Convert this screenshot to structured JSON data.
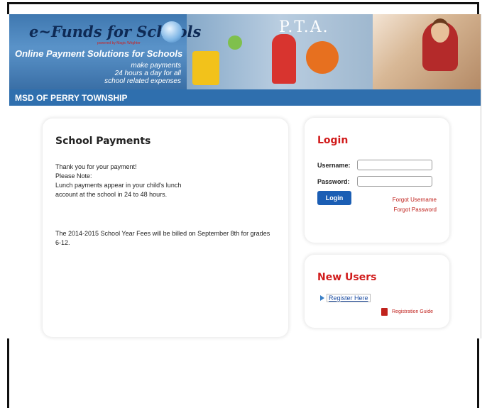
{
  "banner": {
    "brand": "e~Funds for Schools",
    "powered_by": "powered by Magic Wrighter",
    "tagline": "Online Payment Solutions for Schools",
    "subtag_line1": "make payments",
    "subtag_line2": "24 hours a day for all",
    "subtag_line3": "school related expenses",
    "collage_text": "P.T.A."
  },
  "district": "MSD OF PERRY TOWNSHIP",
  "school_payments": {
    "title": "School Payments",
    "msg_line1": "Thank you for your payment!",
    "msg_line2": "Please Note:",
    "msg_line3": "Lunch payments appear in your child's lunch",
    "msg_line4": "account at the school in 24 to 48 hours.",
    "fees_note": "The 2014-2015 School Year Fees will be billed on September 8th for grades 6-12."
  },
  "login": {
    "title": "Login",
    "username_label": "Username:",
    "password_label": "Password:",
    "username_value": "",
    "password_value": "",
    "login_button": "Login",
    "forgot_username": "Forgot Username",
    "forgot_password": "Forgot Password"
  },
  "new_users": {
    "title": "New Users",
    "register_link": "Register Here",
    "guide_link": "Registration Guide"
  },
  "colors": {
    "brand_blue": "#2f6fae",
    "accent_red": "#d11c1c",
    "button_blue": "#1b5eb4"
  },
  "icons": [
    "globe-logo-icon",
    "arrow-right-icon",
    "pdf-icon"
  ]
}
